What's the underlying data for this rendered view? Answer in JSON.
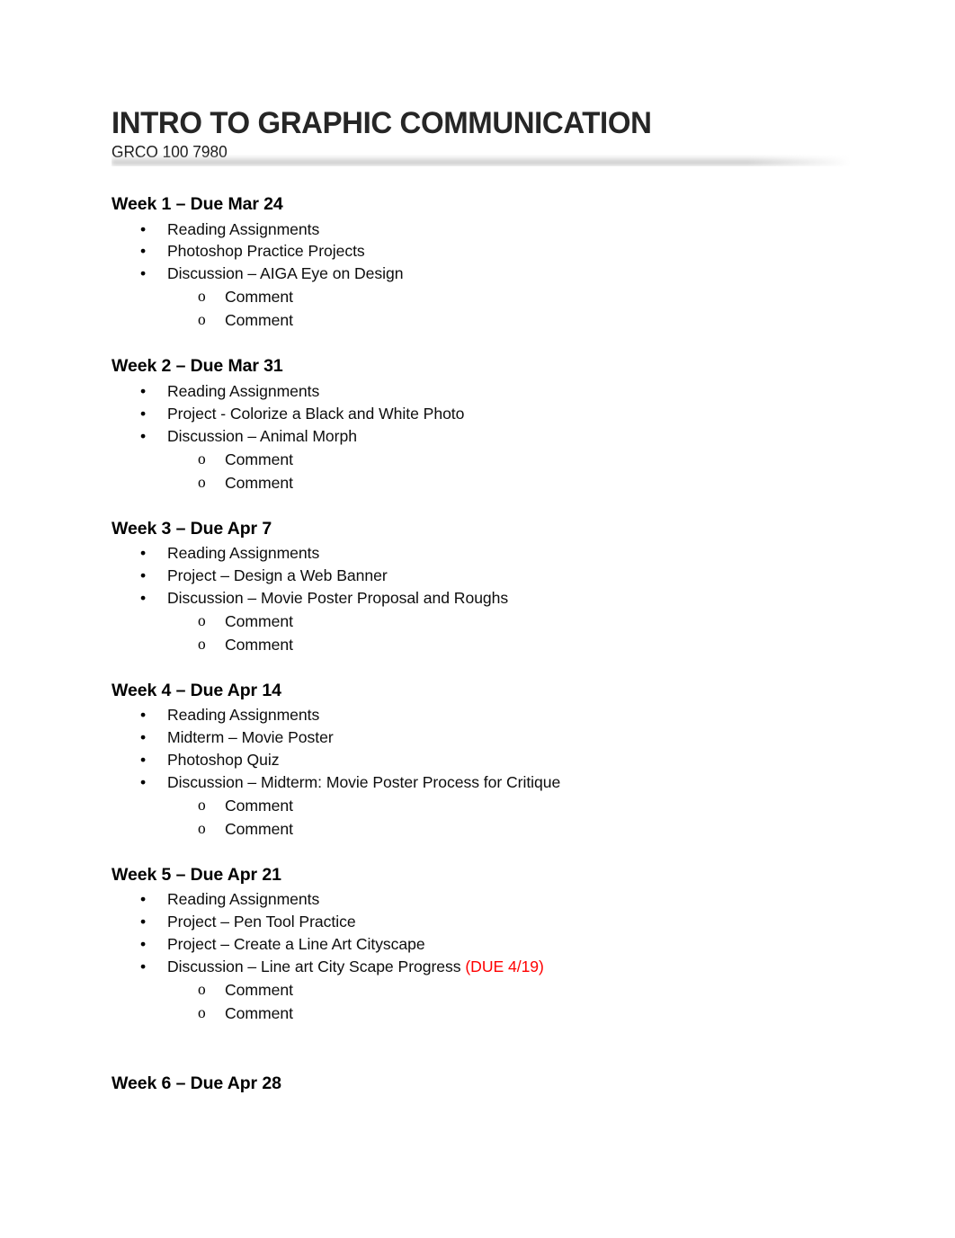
{
  "document": {
    "title": "INTRO TO GRAPHIC COMMUNICATION",
    "subtitle": "GRCO 100 7980",
    "title_color": "#262626",
    "rule_color": "#cecece",
    "accent_red": "#ff0000"
  },
  "markers": {
    "level1": "•",
    "level2": "o"
  },
  "weeks": [
    {
      "heading": "Week 1 – Due Mar 24",
      "items": [
        {
          "text": "Reading Assignments"
        },
        {
          "text": "Photoshop Practice Projects"
        },
        {
          "text": "Discussion – AIGA Eye on Design",
          "subitems": [
            {
              "text": "Comment"
            },
            {
              "text": "Comment"
            }
          ]
        }
      ]
    },
    {
      "heading": "Week 2 – Due Mar 31",
      "items": [
        {
          "text": "Reading Assignments"
        },
        {
          "text": "Project - Colorize a Black and White Photo"
        },
        {
          "text": "Discussion – Animal Morph",
          "subitems": [
            {
              "text": "Comment"
            },
            {
              "text": "Comment"
            }
          ]
        }
      ]
    },
    {
      "heading": "Week 3 – Due Apr 7",
      "items": [
        {
          "text": "Reading Assignments"
        },
        {
          "text": "Project – Design a Web Banner"
        },
        {
          "text": "Discussion – Movie Poster Proposal and Roughs",
          "subitems": [
            {
              "text": "Comment"
            },
            {
              "text": "Comment"
            }
          ]
        }
      ]
    },
    {
      "heading": "Week 4 – Due Apr 14",
      "items": [
        {
          "text": "Reading Assignments"
        },
        {
          "text": "Midterm – Movie Poster"
        },
        {
          "text": "Photoshop Quiz"
        },
        {
          "text": "Discussion – Midterm: Movie Poster Process for Critique",
          "subitems": [
            {
              "text": "Comment"
            },
            {
              "text": "Comment"
            }
          ]
        }
      ]
    },
    {
      "heading": "Week 5 – Due Apr 21",
      "items": [
        {
          "text": "Reading Assignments"
        },
        {
          "text": "Project – Pen Tool Practice"
        },
        {
          "text": "Project – Create a Line Art Cityscape"
        },
        {
          "text": "Discussion – Line art City Scape Progress ",
          "note": "(DUE 4/19)",
          "subitems": [
            {
              "text": "Comment"
            },
            {
              "text": "Comment"
            }
          ]
        }
      ]
    },
    {
      "heading": "Week 6 – Due Apr 28",
      "spaced_before": true,
      "items": []
    }
  ]
}
